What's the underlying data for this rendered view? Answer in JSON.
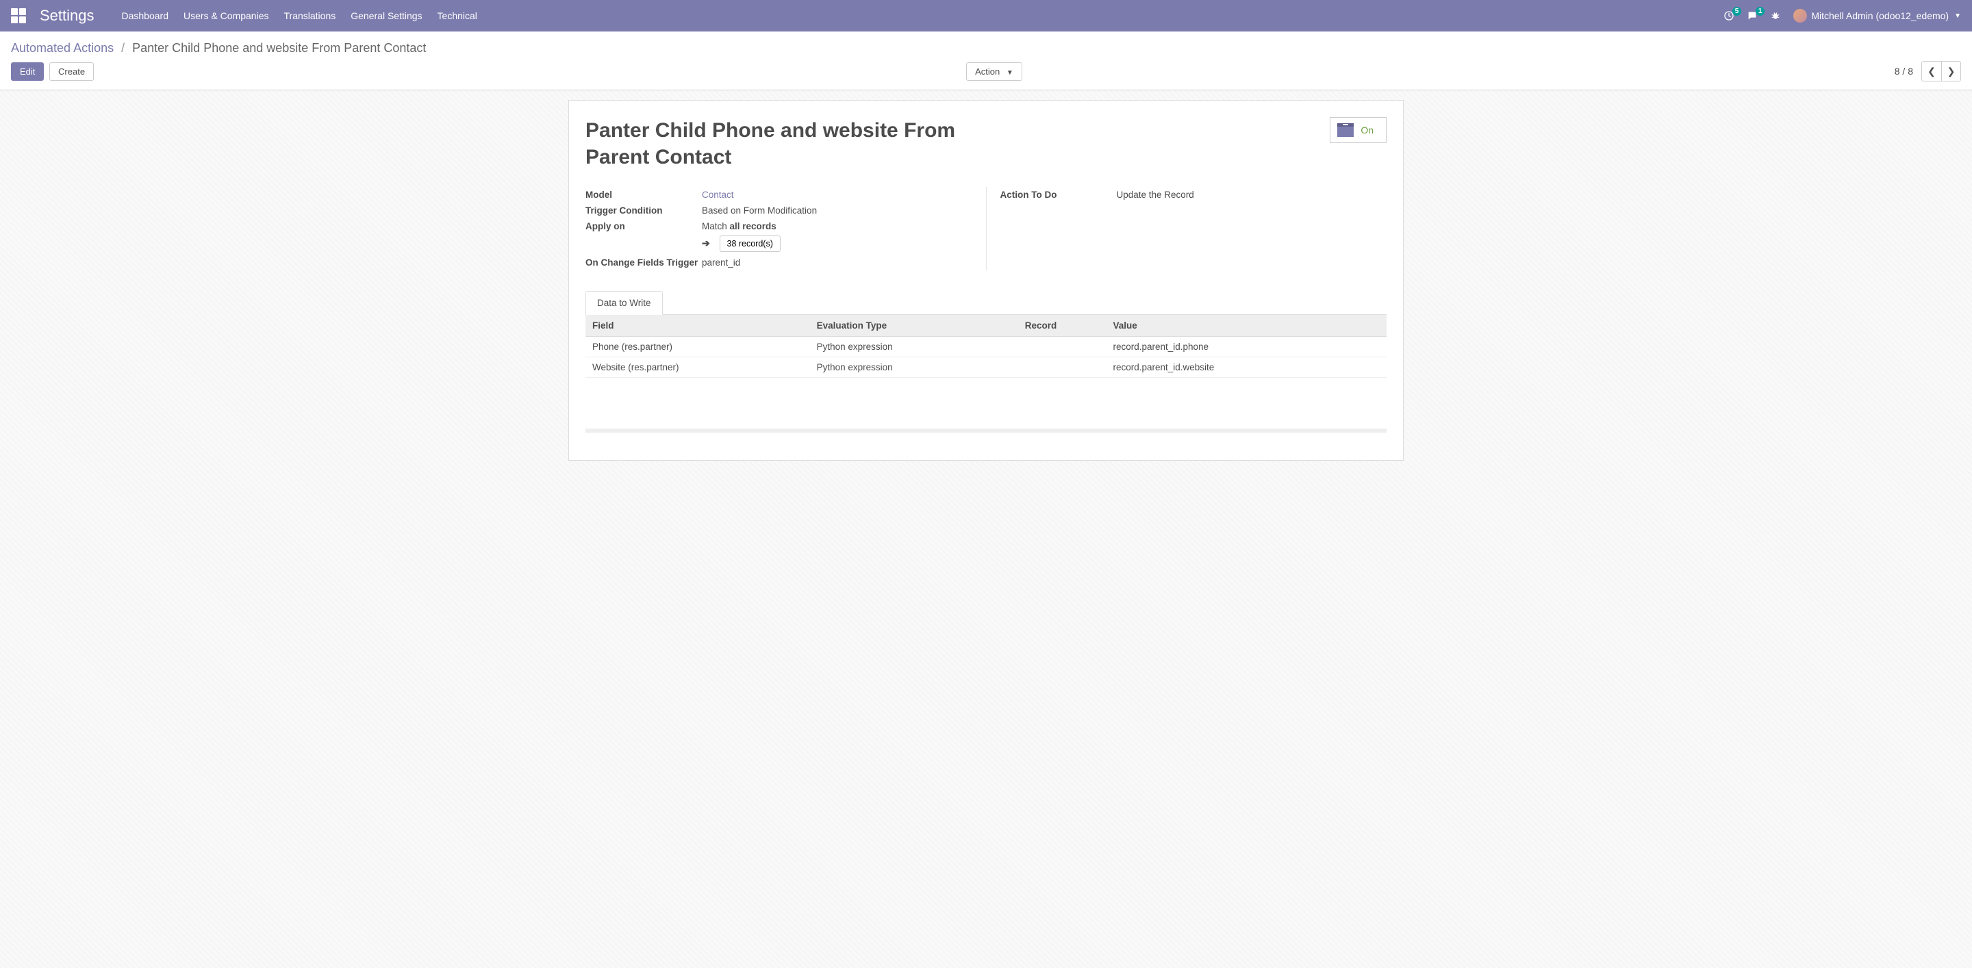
{
  "navbar": {
    "brand": "Settings",
    "menu": [
      "Dashboard",
      "Users & Companies",
      "Translations",
      "General Settings",
      "Technical"
    ],
    "activities_badge": "5",
    "messages_badge": "1",
    "user_name": "Mitchell Admin (odoo12_edemo)"
  },
  "breadcrumb": {
    "parent": "Automated Actions",
    "sep": "/",
    "current": "Panter Child Phone and website From Parent Contact"
  },
  "buttons": {
    "edit": "Edit",
    "create": "Create",
    "action": "Action"
  },
  "pager": {
    "text": "8 / 8"
  },
  "record": {
    "title": "Panter Child Phone and website From Parent Contact",
    "status_label": "On",
    "model_label": "Model",
    "model_value": "Contact",
    "trigger_label": "Trigger Condition",
    "trigger_value": "Based on Form Modification",
    "apply_label": "Apply on",
    "apply_match_prefix": "Match ",
    "apply_match_strong": "all records",
    "domain_count": "38 record(s)",
    "onchange_label": "On Change Fields Trigger",
    "onchange_value": "parent_id",
    "action_label": "Action To Do",
    "action_value": "Update the Record"
  },
  "tab": {
    "data_to_write": "Data to Write"
  },
  "table": {
    "headers": {
      "field": "Field",
      "eval": "Evaluation Type",
      "record": "Record",
      "value": "Value"
    },
    "rows": [
      {
        "field": "Phone (res.partner)",
        "eval": "Python expression",
        "record": "",
        "value": "record.parent_id.phone"
      },
      {
        "field": "Website (res.partner)",
        "eval": "Python expression",
        "record": "",
        "value": "record.parent_id.website"
      }
    ]
  }
}
